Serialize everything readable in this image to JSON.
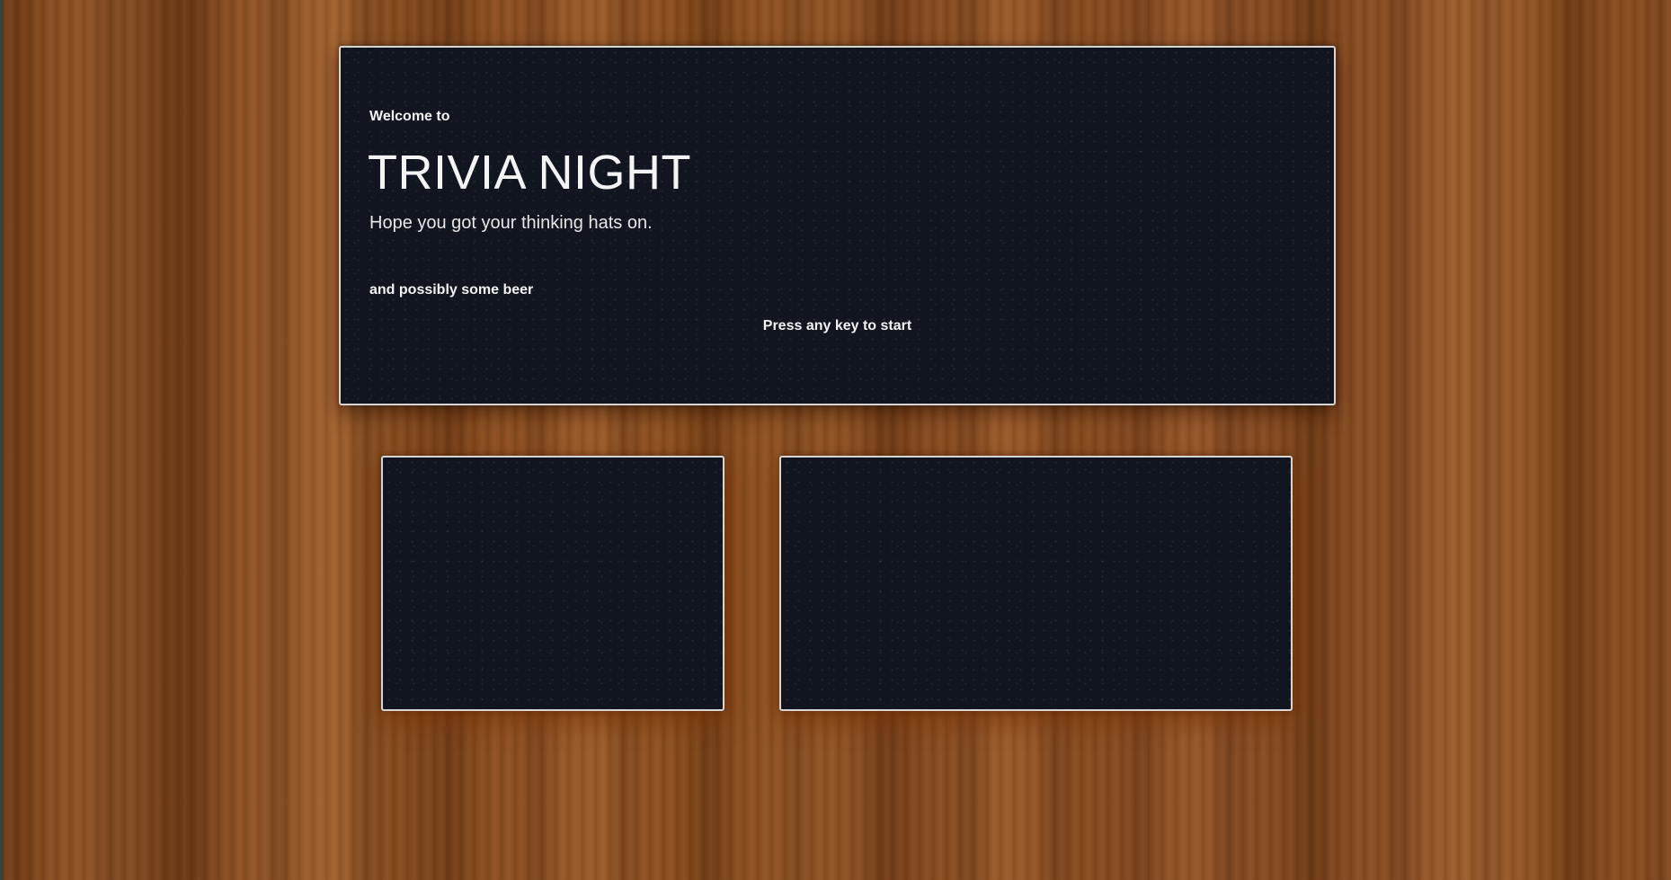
{
  "intro": {
    "welcome_label": "Welcome to",
    "title": "TRIVIA NIGHT",
    "subtitle": "Hope you got your thinking hats on.",
    "aside": "and possibly some beer",
    "start_prompt": "Press any key to start"
  },
  "colors": {
    "board_background": "#101520",
    "board_border": "#d6d6d6",
    "text": "#f2f2f2",
    "wood_base": "#8a4f22"
  }
}
